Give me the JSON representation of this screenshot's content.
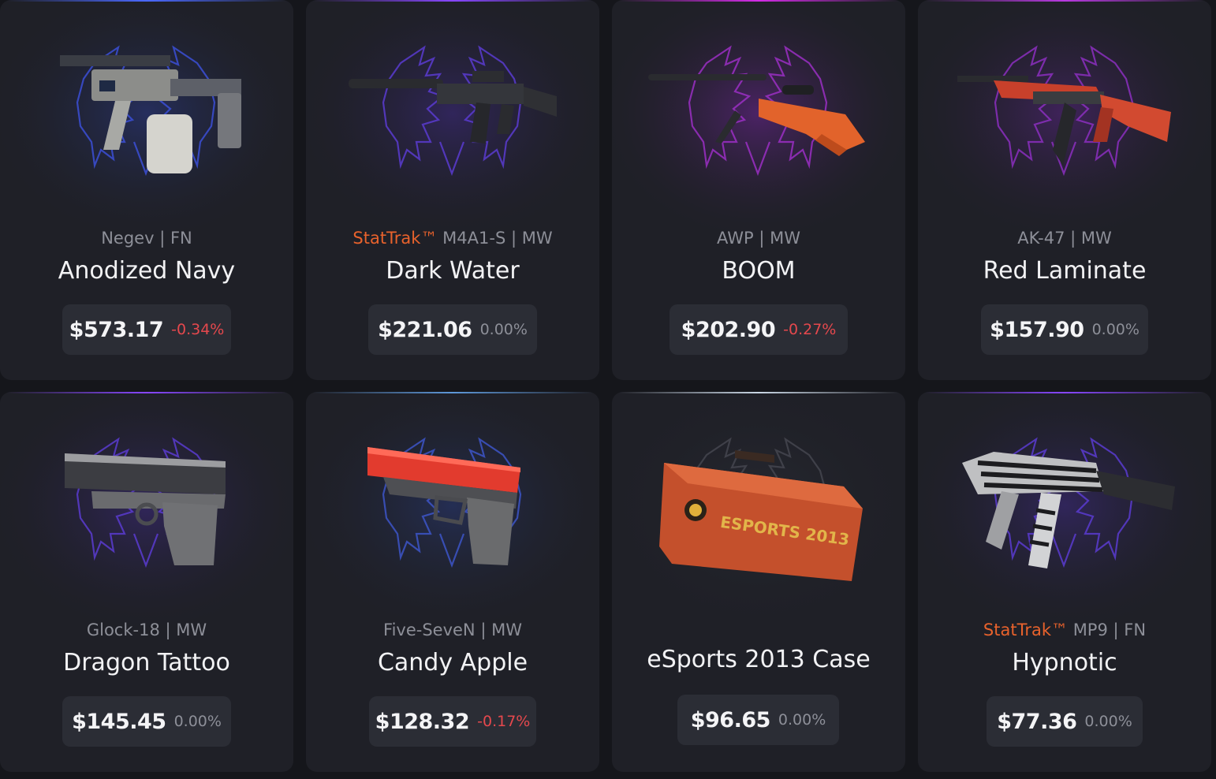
{
  "cards": [
    {
      "type": "Negev",
      "wear": "FN",
      "stattrak": "",
      "name": "Anodized Navy",
      "price": "$573.17",
      "change": "-0.34%",
      "change_dir": "neg",
      "rarity_color": "#4b69ff",
      "item_icon": "negev-gun-icon"
    },
    {
      "type": "M4A1-S",
      "wear": "MW",
      "stattrak": "StatTrak™",
      "name": "Dark Water",
      "price": "$221.06",
      "change": "0.00%",
      "change_dir": "flat",
      "rarity_color": "#8847ff",
      "item_icon": "m4a1s-rifle-icon"
    },
    {
      "type": "AWP",
      "wear": "MW",
      "stattrak": "",
      "name": "BOOM",
      "price": "$202.90",
      "change": "-0.27%",
      "change_dir": "neg",
      "rarity_color": "#d32ce6",
      "item_icon": "awp-sniper-icon"
    },
    {
      "type": "AK-47",
      "wear": "MW",
      "stattrak": "",
      "name": "Red Laminate",
      "price": "$157.90",
      "change": "0.00%",
      "change_dir": "flat",
      "rarity_color": "#d32ce6",
      "item_icon": "ak47-rifle-icon"
    },
    {
      "type": "Glock-18",
      "wear": "MW",
      "stattrak": "",
      "name": "Dragon Tattoo",
      "price": "$145.45",
      "change": "0.00%",
      "change_dir": "flat",
      "rarity_color": "#8847ff",
      "item_icon": "glock-pistol-icon"
    },
    {
      "type": "Five-SeveN",
      "wear": "MW",
      "stattrak": "",
      "name": "Candy Apple",
      "price": "$128.32",
      "change": "-0.17%",
      "change_dir": "neg",
      "rarity_color": "#5e98d9",
      "item_icon": "five-seven-pistol-icon"
    },
    {
      "type": "",
      "wear": "",
      "stattrak": "",
      "name": "eSports 2013 Case",
      "price": "$96.65",
      "change": "0.00%",
      "change_dir": "flat",
      "rarity_color": "#b0c3d9",
      "item_icon": "esports-case-icon",
      "case_label": "ESPORTS 2013"
    },
    {
      "type": "MP9",
      "wear": "FN",
      "stattrak": "StatTrak™",
      "name": "Hypnotic",
      "price": "$77.36",
      "change": "0.00%",
      "change_dir": "flat",
      "rarity_color": "#8847ff",
      "item_icon": "mp9-smg-icon"
    }
  ]
}
